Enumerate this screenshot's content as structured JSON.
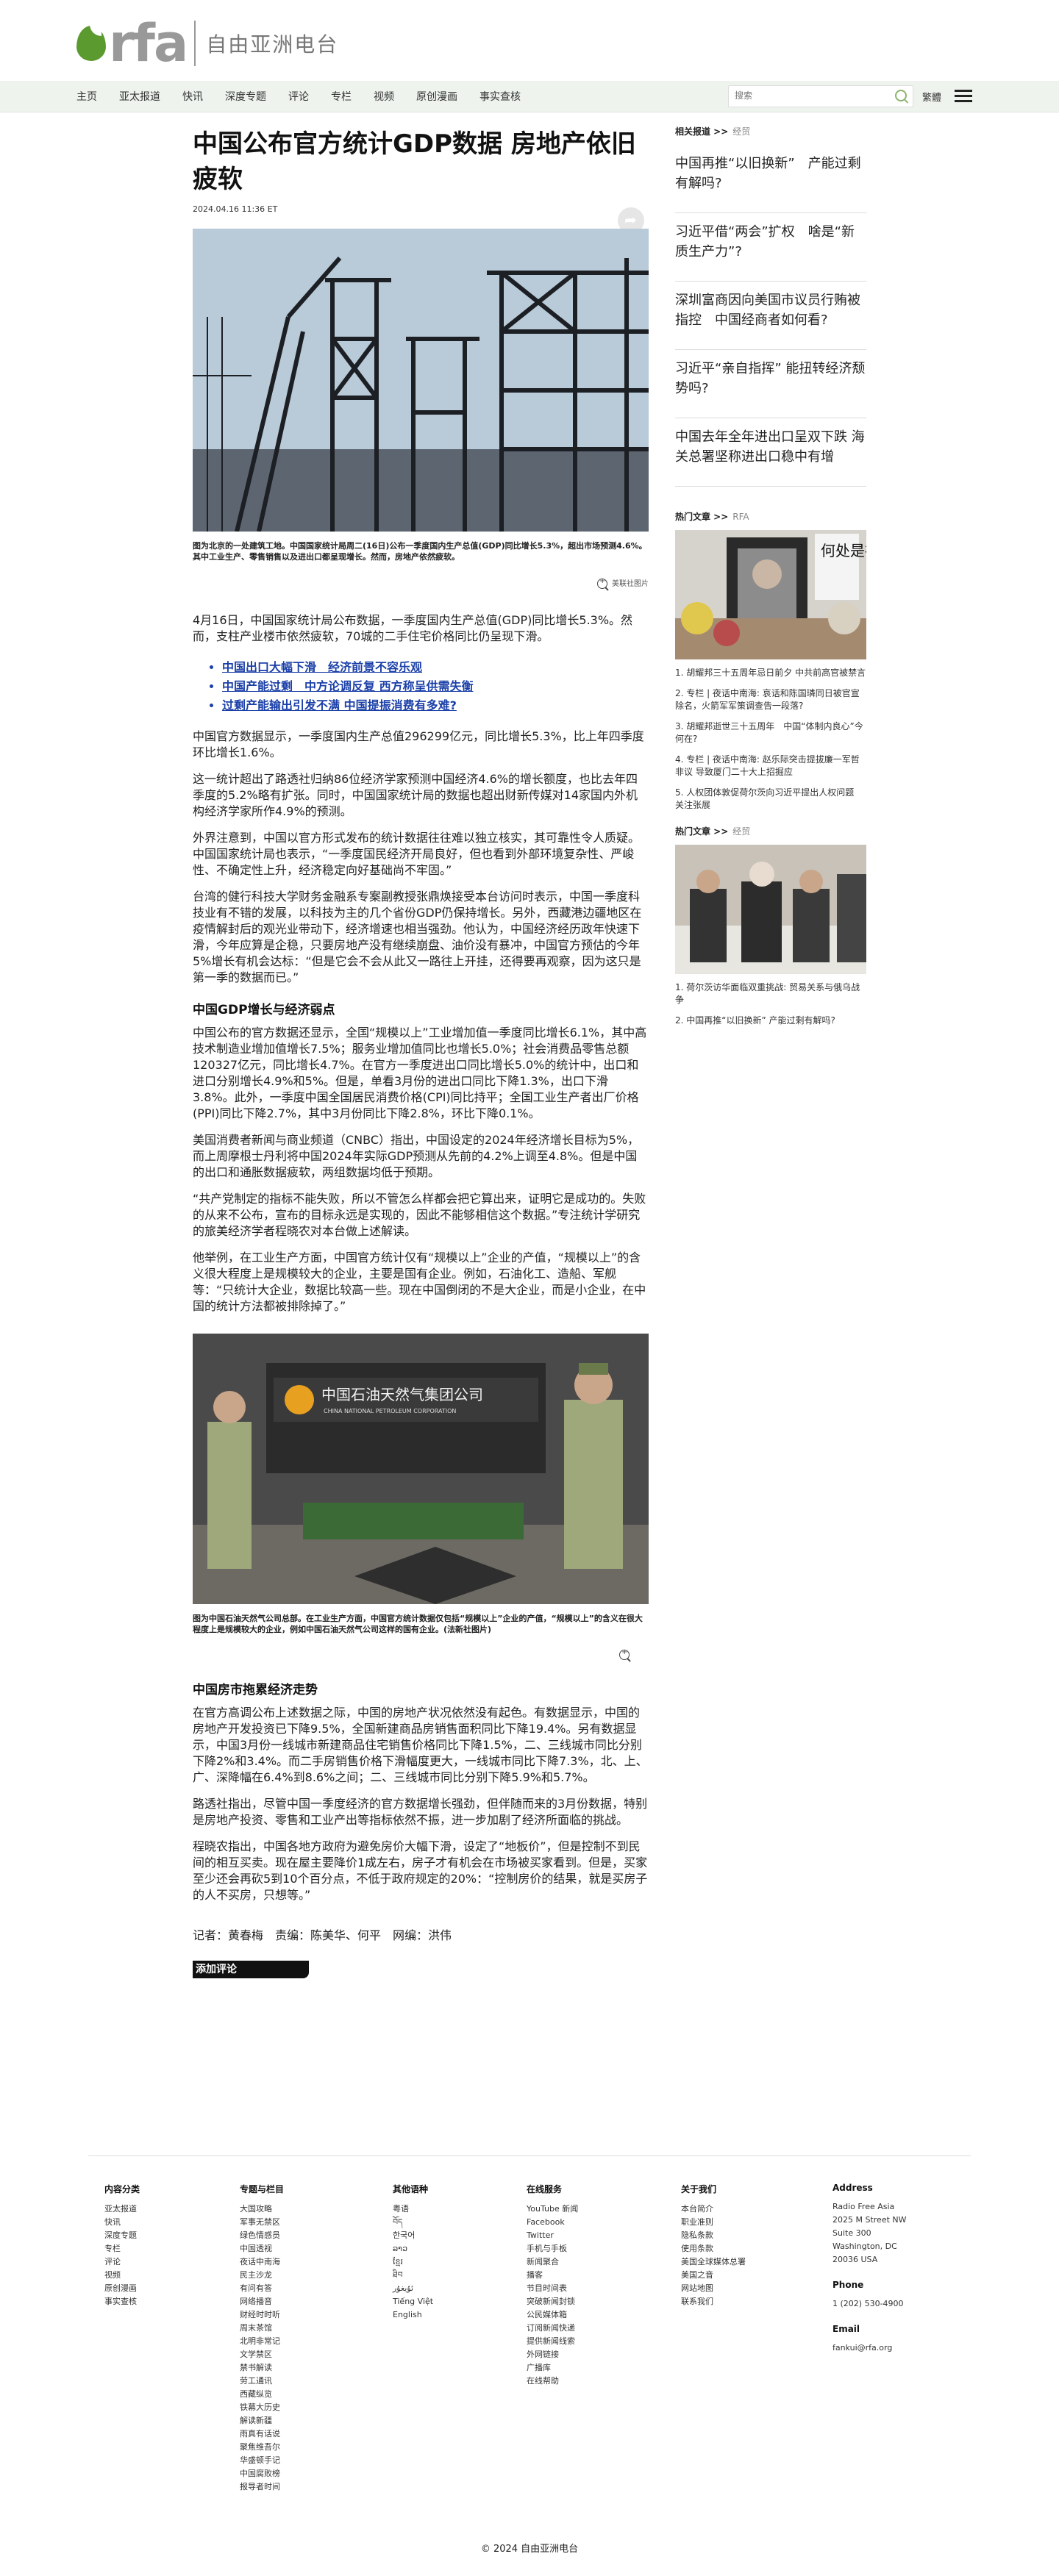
{
  "header": {
    "logo_text": "rfa",
    "logo_cn": "自由亚洲电台",
    "nav": [
      "主页",
      "亚太报道",
      "快讯",
      "深度专题",
      "评论",
      "专栏",
      "视频",
      "原创漫画",
      "事实查核"
    ],
    "search_placeholder": "搜索",
    "lang_toggle": "繁體"
  },
  "article": {
    "title": "中国公布官方统计GDP数据 房地产依旧疲软",
    "date": "2024.04.16 11:36 ET",
    "caption1": "图为北京的一处建筑工地。中国国家统计局周二(16日)公布一季度国内生产总值(GDP)同比增长5.3%，超出市场预测4.6%。其中工业生产、零售销售以及进出口都呈现增长。然而，房地产依然疲软。",
    "credit1": "美联社图片",
    "p1": "4月16日，中国国家统计局公布数据，一季度国内生产总值(GDP)同比增长5.3%。然而，支柱产业楼市依然疲软，70城的二手住宅价格同比仍呈现下滑。",
    "links": [
      "中国出口大幅下滑　经济前景不容乐观",
      "中国产能过剩　中方论调反复 西方称呈供需失衡",
      "过剩产能输出引发不满 中国提振消费有多难?"
    ],
    "p2": "中国官方数据显示，一季度国内生产总值296299亿元，同比增长5.3%，比上年四季度环比增长1.6%。",
    "p3": "这一统计超出了路透社归纳86位经济学家预测中国经济4.6%的增长额度，也比去年四季度的5.2%略有扩张。同时，中国国家统计局的数据也超出财新传媒对14家国内外机构经济学家所作4.9%的预测。",
    "p4": "外界注意到，中国以官方形式发布的统计数据往往难以独立核实，其可靠性令人质疑。中国国家统计局也表示，“一季度国民经济开局良好，但也看到外部环境复杂性、严峻性、不确定性上升，经济稳定向好基础尚不牢固。”",
    "p5": "台湾的健行科技大学财务金融系专案副教授张鼎焕接受本台访问时表示，中国一季度科技业有不错的发展，以科技为主的几个省份GDP仍保持增长。另外，西藏港边疆地区在疫情解封后的观光业带动下，经济增速也相当强劲。他认为，中国经济经历政年快速下滑，今年应算是企稳，只要房地产没有继续崩盘、油价没有暴冲，中国官方预估的今年5%增长有机会达标：“但是它会不会从此又一路往上开挂，还得要再观察，因为这只是第一季的数据而已。”",
    "h1": "中国GDP增长与经济弱点",
    "p6": "中国公布的官方数据还显示，全国“规模以上”工业增加值一季度同比增长6.1%，其中高技术制造业增加值增长7.5%；服务业增加值同比也增长5.0%；社会消费品零售总额120327亿元，同比增长4.7%。在官方一季度进出口同比增长5.0%的统计中，出口和进口分别增长4.9%和5%。但是，单看3月份的进出口同比下降1.3%，出口下滑3.8%。此外，一季度中国全国居民消费价格(CPI)同比持平；全国工业生产者出厂价格(PPI)同比下降2.7%，其中3月份同比下降2.8%，环比下降0.1%。",
    "p7": "美国消费者新闻与商业频道（CNBC）指出，中国设定的2024年经济增长目标为5%，而上周摩根士丹利将中国2024年实际GDP预测从先前的4.2%上调至4.8%。但是中国的出口和通胀数据疲软，两组数据均低于预期。",
    "p8": "“共产党制定的指标不能失败，所以不管怎么样都会把它算出来，证明它是成功的。失败的从来不公布，宣布的目标永远是实现的，因此不能够相信这个数据。”专注统计学研究的旅美经济学者程晓农对本台做上述解读。",
    "p9": "他举例，在工业生产方面，中国官方统计仅有“规模以上”企业的产值，“规模以上”的含义很大程度上是规模较大的企业，主要是国有企业。例如，石油化工、造船、军舰等：“只统计大企业，数据比较高一些。现在中国倒闭的不是大企业，而是小企业，在中国的统计方法都被排除掉了。”",
    "photo2_sign": "中国石油天然气集团公司",
    "photo2_sign_en": "CHINA NATIONAL PETROLEUM CORPORATION",
    "caption2": "图为中国石油天然气公司总部。在工业生产方面，中国官方统计数据仅包括“规模以上”企业的产值，“规模以上”的含义在很大程度上是规模较大的企业，例如中国石油天然气公司这样的国有企业。(法新社图片)",
    "h2": "中国房市拖累经济走势",
    "p10": "在官方高调公布上述数据之际，中国的房地产状况依然没有起色。有数据显示，中国的房地产开发投资已下降9.5%，全国新建商品房销售面积同比下降19.4%。另有数据显示，中国3月份一线城市新建商品住宅销售价格同比下降1.5%，二、三线城市同比分别下降2%和3.4%。而二手房销售价格下滑幅度更大，一线城市同比下降7.3%，北、上、广、深降幅在6.4%到8.6%之间；二、三线城市同比分别下降5.9%和5.7%。",
    "p11": "路透社指出，尽管中国一季度经济的官方数据增长强劲，但伴随而来的3月份数据，特别是房地产投资、零售和工业产出等指标依然不振，进一步加剧了经济所面临的挑战。",
    "p12": "程晓农指出，中国各地方政府为避免房价大幅下滑，设定了“地板价”，但是控制不到民间的相互买卖。现在屋主要降价1成左右，房子才有机会在市场被买家看到。但是，买家至少还会再砍5到10个百分点，不低于政府规定的20%：“控制房价的结果，就是买房子的人不买房，只想等。”",
    "byline": "记者：黄春梅　责编：陈美华、何平　网编：洪伟",
    "comment": "添加评论"
  },
  "sidebar": {
    "related_head": "相关报道 >>",
    "related_sub": "经贸",
    "related": [
      "中国再推“以旧换新”　产能过剩有解吗?",
      "习近平借“两会”扩权　啥是“新质生产力”?",
      "深圳富商因向美国市议员行贿被指控　中国经商者如何看?",
      "习近平“亲自指挥” 能扭转经济颓势吗?",
      "中国去年全年进出口呈双下跌 海关总署坚称进出口稳中有增"
    ],
    "hot_head": "热门文章 >>",
    "hot_sub": "RFA",
    "hot_sign": "何处是祖",
    "hot_list": [
      "1. 胡耀邦三十五周年忌日前夕 中共前高官被禁言",
      "2. 专栏 | 夜话中南海: 哀话和陈国璘同日被官宣除名，火箭军军策调查告一段落?",
      "3. 胡耀邦逝世三十五周年　中国“体制内良心”今何在?",
      "4. 专栏 | 夜话中南海: 赵乐际突击提拔廉一军哲非议 导致厦门二十大上招掘应",
      "5. 人权团体敦促荷尔茨向习近平提出人权问题　关注张展"
    ],
    "hot2_sub": "经贸",
    "hot2_list": [
      "1. 荷尔茨访华面临双重挑战: 贸易关系与俄乌战争",
      "2. 中国再推“以旧换新” 产能过剩有解吗?"
    ]
  },
  "footer": {
    "cols": [
      {
        "head": "内容分类",
        "items": [
          "亚太报道",
          "快讯",
          "深度专题",
          "专栏",
          "评论",
          "视频",
          "原创漫画",
          "事实查核"
        ]
      },
      {
        "head": "专题与栏目",
        "items": [
          "大国攻略",
          "军事无禁区",
          "绿色情感员",
          "中国透视",
          "夜话中南海",
          "民主沙龙",
          "有问有答",
          "网络播音",
          "财经时时听",
          "周末茶馆",
          "北明非常记",
          "文学禁区",
          "禁书解读",
          "劳工通讯",
          "西藏纵览",
          "铁幕大历史",
          "解读新疆",
          "雨真有话说",
          "聚焦维吾尔",
          "华盛顿手记",
          "中国腐败榜",
          "报导者时间"
        ]
      },
      {
        "head": "其他语种",
        "items": [
          "粤语",
          "བོད",
          "한국어",
          "ລາວ",
          "ខ្មែរ",
          "ཐིབ",
          "ئۇيغۇر",
          "Tiếng Việt",
          "English"
        ]
      },
      {
        "head": "在线服务",
        "items": [
          "YouTube 新闻",
          "Facebook",
          "Twitter",
          "手机与手板",
          "新闻聚合",
          "播客",
          "节目时间表",
          "突破新闻封锁",
          "公民媒体箱",
          "订阅新闻快递",
          "提供新闻线索",
          "外网链接",
          "广播库",
          "在线帮助"
        ]
      },
      {
        "head": "关于我们",
        "items": [
          "本台简介",
          "职业准则",
          "隐私条款",
          "使用条款",
          "美国全球媒体总署",
          "美国之音",
          "网站地图",
          "联系我们"
        ]
      },
      {
        "head": "Address",
        "items": [
          "Radio Free Asia",
          "2025 M Street NW",
          "Suite 300",
          "Washington, DC",
          "20036 USA"
        ],
        "phone_head": "Phone",
        "phone": "1 (202) 530-4900",
        "email_head": "Email",
        "email": "fankui@rfa.org"
      }
    ],
    "copyright": "© 2024 自由亚洲电台"
  }
}
